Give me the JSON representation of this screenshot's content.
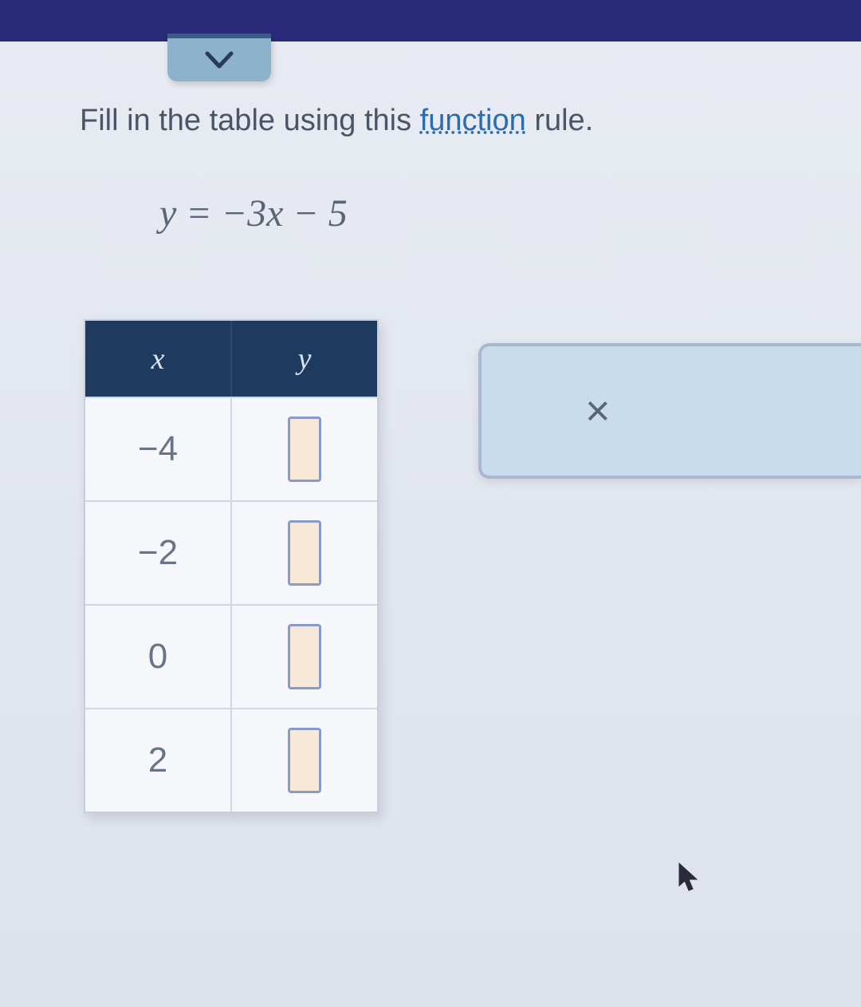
{
  "instruction": {
    "prefix": "Fill in the table using this ",
    "link": "function",
    "suffix": " rule."
  },
  "equation": "y = −3x − 5",
  "table": {
    "headers": [
      "x",
      "y"
    ],
    "rows": [
      {
        "x": "−4",
        "y": ""
      },
      {
        "x": "−2",
        "y": ""
      },
      {
        "x": "0",
        "y": ""
      },
      {
        "x": "2",
        "y": ""
      }
    ]
  },
  "side_panel": {
    "symbol": "×"
  }
}
